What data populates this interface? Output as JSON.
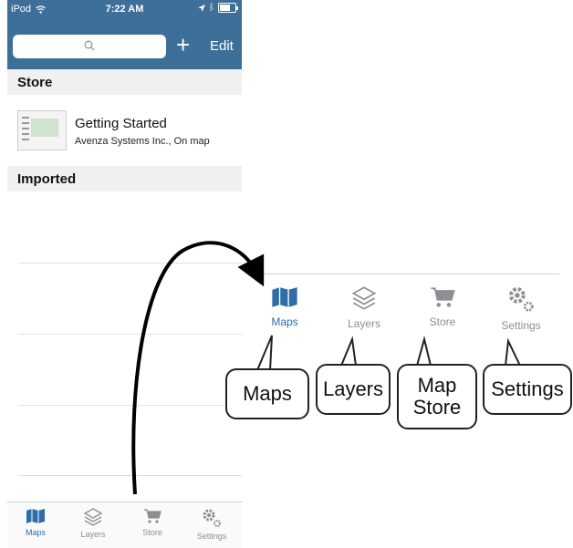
{
  "status_bar": {
    "device": "iPod",
    "time": "7:22 AM"
  },
  "nav": {
    "plus": "+",
    "edit": "Edit"
  },
  "sections": {
    "store": "Store",
    "imported": "Imported"
  },
  "store_item": {
    "title": "Getting Started",
    "subtitle": "Avenza Systems Inc., On map"
  },
  "tabs": [
    {
      "label": "Maps",
      "icon": "map-icon",
      "active": true
    },
    {
      "label": "Layers",
      "icon": "layers-icon"
    },
    {
      "label": "Store",
      "icon": "cart-icon"
    },
    {
      "label": "Settings",
      "icon": "gear-icon"
    }
  ],
  "callouts": [
    "Maps",
    "Layers",
    "Map Store",
    "Settings"
  ],
  "colors": {
    "nav_bar": "#3d6f99",
    "tab_active": "#2f6da6",
    "tab_inactive": "#8e8e93"
  }
}
